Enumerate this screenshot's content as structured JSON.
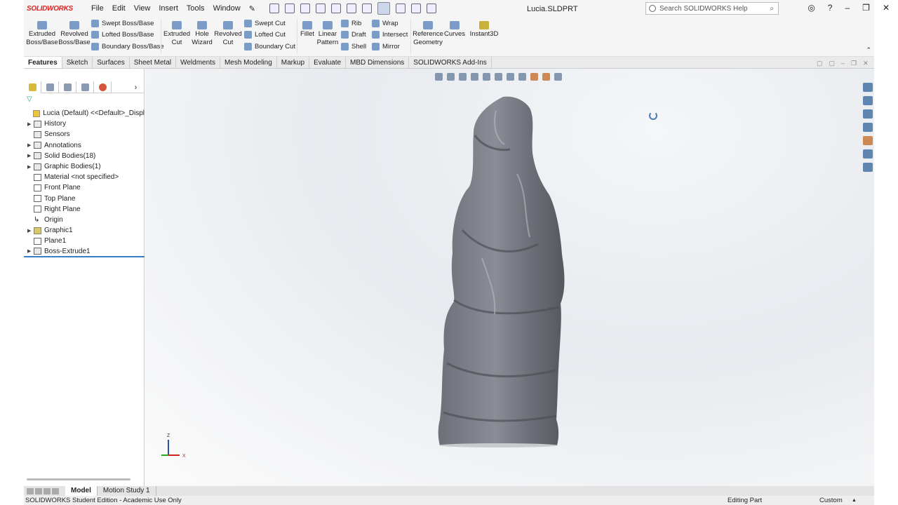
{
  "app": {
    "logo": "SOLIDWORKS",
    "document_title": "Lucia.SLDPRT"
  },
  "menu": [
    "File",
    "Edit",
    "View",
    "Insert",
    "Tools",
    "Window"
  ],
  "search": {
    "placeholder": "Search SOLIDWORKS Help"
  },
  "ribbon": {
    "extruded_boss": "Extruded Boss/Base",
    "revolved_boss": "Revolved Boss/Base",
    "swept_boss": "Swept Boss/Base",
    "lofted_boss": "Lofted Boss/Base",
    "boundary_boss": "Boundary Boss/Base",
    "extruded_cut": "Extruded Cut",
    "hole_wizard": "Hole Wizard",
    "revolved_cut": "Revolved Cut",
    "swept_cut": "Swept Cut",
    "lofted_cut": "Lofted Cut",
    "boundary_cut": "Boundary Cut",
    "fillet": "Fillet",
    "linear_pattern": "Linear Pattern",
    "rib": "Rib",
    "draft": "Draft",
    "shell": "Shell",
    "wrap": "Wrap",
    "intersect": "Intersect",
    "mirror": "Mirror",
    "reference_geometry": "Reference Geometry",
    "curves": "Curves",
    "instant3d": "Instant3D"
  },
  "tabs": [
    "Features",
    "Sketch",
    "Surfaces",
    "Sheet Metal",
    "Weldments",
    "Mesh Modeling",
    "Markup",
    "Evaluate",
    "MBD Dimensions",
    "SOLIDWORKS Add-Ins"
  ],
  "tree": {
    "root": "Lucia (Default) <<Default>_Displ",
    "items": [
      {
        "label": "History",
        "expandable": true
      },
      {
        "label": "Sensors",
        "expandable": false
      },
      {
        "label": "Annotations",
        "expandable": true
      },
      {
        "label": "Solid Bodies(18)",
        "expandable": true
      },
      {
        "label": "Graphic Bodies(1)",
        "expandable": true
      },
      {
        "label": "Material <not specified>",
        "expandable": false
      },
      {
        "label": "Front Plane",
        "expandable": false
      },
      {
        "label": "Top Plane",
        "expandable": false
      },
      {
        "label": "Right Plane",
        "expandable": false
      },
      {
        "label": "Origin",
        "expandable": false
      },
      {
        "label": "Graphic1",
        "expandable": true
      },
      {
        "label": "Plane1",
        "expandable": false
      },
      {
        "label": "Boss-Extrude1",
        "expandable": true
      }
    ]
  },
  "bottom_tabs": [
    "Model",
    "Motion Study 1"
  ],
  "status": {
    "edition": "SOLIDWORKS Student Edition - Academic Use Only",
    "mode": "Editing Part",
    "units": "Custom"
  },
  "triad": {
    "z": "Z",
    "x": "X"
  }
}
